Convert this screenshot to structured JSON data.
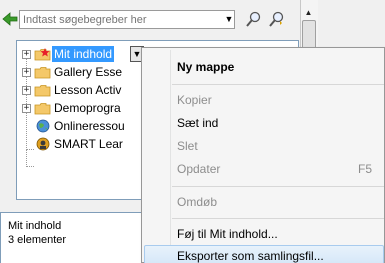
{
  "search": {
    "placeholder": "Indtast søgebegreber her",
    "icons": [
      "back-arrow-icon",
      "search-icon",
      "advanced-search-icon"
    ]
  },
  "tree": {
    "nodes": [
      {
        "label": "Mit indhold",
        "icon": "folder-star-icon",
        "expandable": true,
        "selected": true
      },
      {
        "label": "Gallery Esse",
        "icon": "folder-icon",
        "expandable": true
      },
      {
        "label": "Lesson Activ",
        "icon": "folder-icon",
        "expandable": true
      },
      {
        "label": "Demoprogra",
        "icon": "folder-icon",
        "expandable": true
      },
      {
        "label": "Onlineressou",
        "icon": "globe-icon",
        "expandable": false
      },
      {
        "label": "SMART Lear",
        "icon": "smart-icon",
        "expandable": false
      }
    ]
  },
  "info": {
    "title": "Mit indhold",
    "count": "3 elementer"
  },
  "context_menu": {
    "items": [
      {
        "label": "Ny mappe",
        "bold": true,
        "disabled": false
      },
      {
        "label": "Kopier",
        "disabled": true
      },
      {
        "label": "Sæt ind",
        "disabled": false
      },
      {
        "label": "Slet",
        "disabled": true
      },
      {
        "label": "Opdater",
        "disabled": true,
        "shortcut": "F5"
      },
      {
        "label": "Omdøb",
        "disabled": true
      },
      {
        "label": "Føj til Mit indhold...",
        "disabled": false
      },
      {
        "label": "Eksporter som samlingsfil...",
        "disabled": false,
        "hover": true
      }
    ]
  },
  "colors": {
    "selection": "#3399ff",
    "menu_hover": "#d4e6f8",
    "disabled_text": "#8d8d8d"
  }
}
